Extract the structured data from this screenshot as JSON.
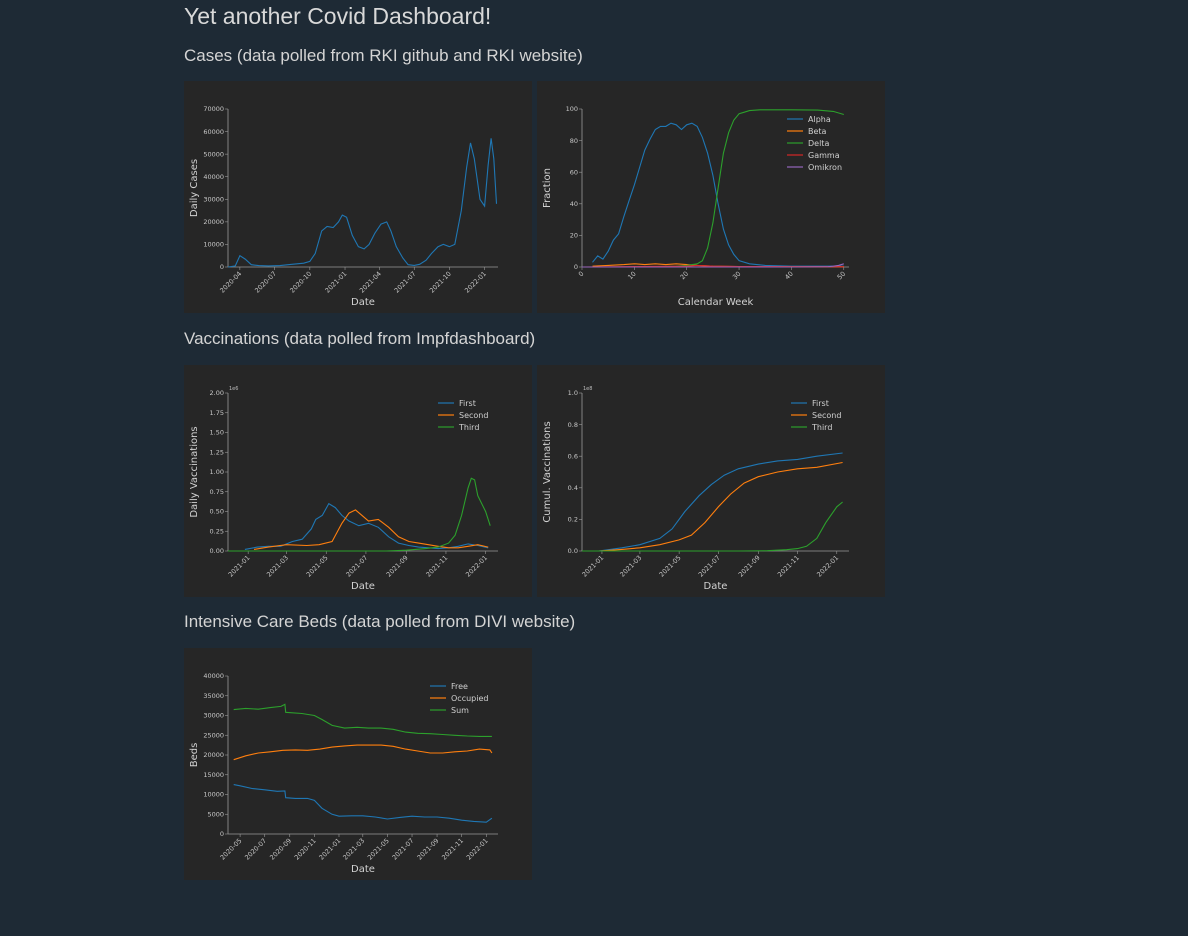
{
  "page": {
    "title": "Yet another Covid Dashboard!",
    "background": "#1e2a35",
    "panel_background": "#262626"
  },
  "sections": {
    "cases": "Cases (data polled from RKI github and RKI website)",
    "vaccinations": "Vaccinations (data polled from Impfdashboard)",
    "icu": "Intensive Care Beds (data polled from DIVI website)"
  },
  "colors": {
    "blue": "#1f77b4",
    "orange": "#ff7f0e",
    "green": "#2ca02c",
    "red": "#d62728",
    "purple": "#9467bd"
  },
  "chart_data": [
    {
      "id": "daily-cases",
      "type": "line",
      "xlabel": "Date",
      "ylabel": "Daily Cases",
      "x_ticks": [
        "2020-04",
        "2020-07",
        "2020-10",
        "2021-01",
        "2021-04",
        "2021-07",
        "2021-10",
        "2022-01"
      ],
      "xlim": [
        "2020-03-01",
        "2022-02-05"
      ],
      "y_ticks": [
        0,
        10000,
        20000,
        30000,
        40000,
        50000,
        60000,
        70000
      ],
      "ylim": [
        0,
        70000
      ],
      "legend": "none",
      "series": [
        {
          "color": "blue",
          "x": [
            "2020-03-01",
            "2020-03-20",
            "2020-04-01",
            "2020-04-15",
            "2020-05-01",
            "2020-05-20",
            "2020-06-15",
            "2020-07-15",
            "2020-08-15",
            "2020-09-15",
            "2020-10-01",
            "2020-10-15",
            "2020-11-01",
            "2020-11-15",
            "2020-12-01",
            "2020-12-15",
            "2020-12-25",
            "2021-01-05",
            "2021-01-20",
            "2021-02-05",
            "2021-02-20",
            "2021-03-05",
            "2021-03-20",
            "2021-04-05",
            "2021-04-20",
            "2021-05-01",
            "2021-05-15",
            "2021-06-01",
            "2021-06-15",
            "2021-07-01",
            "2021-07-15",
            "2021-08-01",
            "2021-08-15",
            "2021-09-01",
            "2021-09-15",
            "2021-10-01",
            "2021-10-15",
            "2021-11-01",
            "2021-11-15",
            "2021-11-25",
            "2021-12-05",
            "2021-12-20",
            "2022-01-01",
            "2022-01-10",
            "2022-01-18",
            "2022-01-25",
            "2022-02-01"
          ],
          "values": [
            0,
            500,
            5000,
            3500,
            1000,
            600,
            500,
            600,
            1200,
            1700,
            2500,
            6000,
            16000,
            18000,
            17500,
            20000,
            23000,
            22000,
            14000,
            9000,
            8000,
            10000,
            15000,
            19000,
            20000,
            16000,
            9000,
            4000,
            1000,
            700,
            1200,
            3000,
            6000,
            9000,
            10000,
            9000,
            10000,
            25000,
            44000,
            55000,
            48000,
            30000,
            27000,
            45000,
            57000,
            48000,
            28000
          ]
        }
      ]
    },
    {
      "id": "variant-fraction",
      "type": "line",
      "xlabel": "Calendar Week",
      "ylabel": "Fraction",
      "x_ticks": [
        0,
        10,
        20,
        30,
        40,
        50
      ],
      "xlim": [
        0,
        51
      ],
      "y_ticks": [
        0,
        20,
        40,
        60,
        80,
        100
      ],
      "ylim": [
        0,
        100
      ],
      "legend": "top-right",
      "series": [
        {
          "name": "Alpha",
          "color": "blue",
          "x": [
            2,
            3,
            4,
            5,
            6,
            7,
            8,
            9,
            10,
            11,
            12,
            13,
            14,
            15,
            16,
            17,
            18,
            19,
            20,
            21,
            22,
            23,
            24,
            25,
            26,
            27,
            28,
            29,
            30,
            32,
            35,
            40,
            45,
            50
          ],
          "values": [
            3,
            7,
            5,
            10,
            17,
            21,
            32,
            42,
            52,
            63,
            74,
            81,
            87,
            89,
            89,
            91,
            90,
            87,
            90,
            91,
            89,
            82,
            72,
            58,
            40,
            24,
            14,
            8,
            4,
            2,
            1,
            0.5,
            0.5,
            0.5
          ]
        },
        {
          "name": "Beta",
          "color": "orange",
          "x": [
            2,
            5,
            8,
            10,
            12,
            14,
            16,
            18,
            20,
            22,
            25,
            30,
            40,
            50
          ],
          "values": [
            0.5,
            1,
            1.5,
            2,
            1.5,
            2,
            1.5,
            2,
            1.5,
            1,
            0.5,
            0.3,
            0.2,
            0.2
          ]
        },
        {
          "name": "Delta",
          "color": "green",
          "x": [
            0,
            10,
            18,
            20,
            22,
            23,
            24,
            25,
            26,
            27,
            28,
            29,
            30,
            31,
            32,
            34,
            36,
            40,
            45,
            48,
            50
          ],
          "values": [
            0,
            0,
            0.5,
            1,
            2,
            4,
            12,
            28,
            50,
            72,
            85,
            93,
            97,
            98,
            99,
            99.5,
            99.5,
            99.5,
            99.3,
            98.5,
            96.5
          ]
        },
        {
          "name": "Gamma",
          "color": "red",
          "x": [
            0,
            10,
            20,
            22,
            25,
            30,
            40,
            50
          ],
          "values": [
            0,
            0.3,
            0.5,
            1,
            0.5,
            0.3,
            0.2,
            0.2
          ]
        },
        {
          "name": "Omikron",
          "color": "purple",
          "x": [
            0,
            40,
            47,
            48,
            49,
            50
          ],
          "values": [
            0,
            0,
            0.2,
            0.5,
            1,
            2
          ]
        }
      ]
    },
    {
      "id": "daily-vaccinations",
      "type": "line",
      "xlabel": "Date",
      "ylabel": "Daily Vaccinations",
      "y_offset_label": "1e6",
      "x_ticks": [
        "2021-01",
        "2021-03",
        "2021-05",
        "2021-07",
        "2021-09",
        "2021-11",
        "2022-01"
      ],
      "xlim": [
        "2020-12-01",
        "2022-01-20"
      ],
      "y_ticks": [
        "0.00",
        "0.25",
        "0.50",
        "0.75",
        "1.00",
        "1.25",
        "1.50",
        "1.75",
        "2.00"
      ],
      "ylim": [
        0,
        2
      ],
      "legend": "top-right",
      "series": [
        {
          "name": "First",
          "color": "blue",
          "x": [
            "2020-12-27",
            "2021-01-15",
            "2021-02-01",
            "2021-02-20",
            "2021-03-10",
            "2021-03-25",
            "2021-04-08",
            "2021-04-15",
            "2021-04-25",
            "2021-05-05",
            "2021-05-15",
            "2021-05-25",
            "2021-06-05",
            "2021-06-20",
            "2021-07-05",
            "2021-07-20",
            "2021-08-05",
            "2021-08-20",
            "2021-09-05",
            "2021-09-20",
            "2021-10-05",
            "2021-10-20",
            "2021-11-05",
            "2021-11-20",
            "2021-12-05",
            "2021-12-20",
            "2022-01-05"
          ],
          "values": [
            0.02,
            0.05,
            0.06,
            0.06,
            0.12,
            0.15,
            0.28,
            0.4,
            0.45,
            0.6,
            0.55,
            0.45,
            0.38,
            0.32,
            0.35,
            0.3,
            0.18,
            0.1,
            0.07,
            0.05,
            0.04,
            0.03,
            0.04,
            0.06,
            0.09,
            0.07,
            0.04
          ]
        },
        {
          "name": "Second",
          "color": "orange",
          "x": [
            "2021-01-10",
            "2021-02-01",
            "2021-03-01",
            "2021-04-01",
            "2021-04-20",
            "2021-05-10",
            "2021-05-25",
            "2021-06-05",
            "2021-06-15",
            "2021-06-25",
            "2021-07-05",
            "2021-07-20",
            "2021-08-05",
            "2021-08-20",
            "2021-09-05",
            "2021-09-20",
            "2021-10-05",
            "2021-10-20",
            "2021-11-05",
            "2021-11-20",
            "2021-12-05",
            "2021-12-20",
            "2022-01-05"
          ],
          "values": [
            0.02,
            0.05,
            0.08,
            0.07,
            0.08,
            0.12,
            0.35,
            0.48,
            0.52,
            0.45,
            0.38,
            0.4,
            0.3,
            0.18,
            0.12,
            0.1,
            0.08,
            0.06,
            0.04,
            0.04,
            0.06,
            0.08,
            0.05
          ]
        },
        {
          "name": "Third",
          "color": "green",
          "x": [
            "2020-12-01",
            "2021-08-01",
            "2021-09-01",
            "2021-10-01",
            "2021-10-20",
            "2021-11-05",
            "2021-11-15",
            "2021-11-25",
            "2021-12-05",
            "2021-12-10",
            "2021-12-15",
            "2021-12-20",
            "2022-01-01",
            "2022-01-08"
          ],
          "values": [
            0,
            0,
            0.01,
            0.03,
            0.05,
            0.1,
            0.2,
            0.45,
            0.8,
            0.92,
            0.9,
            0.7,
            0.5,
            0.32
          ]
        }
      ]
    },
    {
      "id": "cumulative-vaccinations",
      "type": "line",
      "xlabel": "Date",
      "ylabel": "Cumul. Vaccinations",
      "y_offset_label": "1e8",
      "x_ticks": [
        "2021-01",
        "2021-03",
        "2021-05",
        "2021-07",
        "2021-09",
        "2021-11",
        "2022-01"
      ],
      "xlim": [
        "2020-12-01",
        "2022-01-20"
      ],
      "y_ticks": [
        "0.0",
        "0.2",
        "0.4",
        "0.6",
        "0.8",
        "1.0"
      ],
      "ylim": [
        0,
        1
      ],
      "legend": "top-right",
      "series": [
        {
          "name": "First",
          "color": "blue",
          "x": [
            "2020-12-27",
            "2021-02-01",
            "2021-03-01",
            "2021-04-01",
            "2021-04-20",
            "2021-05-10",
            "2021-06-01",
            "2021-06-20",
            "2021-07-10",
            "2021-08-01",
            "2021-09-01",
            "2021-10-01",
            "2021-11-01",
            "2021-12-01",
            "2022-01-10"
          ],
          "values": [
            0,
            0.02,
            0.04,
            0.08,
            0.14,
            0.25,
            0.35,
            0.42,
            0.48,
            0.52,
            0.55,
            0.57,
            0.58,
            0.6,
            0.62
          ]
        },
        {
          "name": "Second",
          "color": "orange",
          "x": [
            "2020-12-27",
            "2021-02-01",
            "2021-03-01",
            "2021-04-01",
            "2021-05-01",
            "2021-05-20",
            "2021-06-10",
            "2021-07-01",
            "2021-07-20",
            "2021-08-10",
            "2021-09-01",
            "2021-10-01",
            "2021-11-01",
            "2021-12-01",
            "2022-01-10"
          ],
          "values": [
            0,
            0.01,
            0.02,
            0.04,
            0.07,
            0.1,
            0.18,
            0.28,
            0.36,
            0.43,
            0.47,
            0.5,
            0.52,
            0.53,
            0.56
          ]
        },
        {
          "name": "Third",
          "color": "green",
          "x": [
            "2020-12-01",
            "2021-08-01",
            "2021-09-15",
            "2021-10-15",
            "2021-11-01",
            "2021-11-15",
            "2021-12-01",
            "2021-12-15",
            "2022-01-01",
            "2022-01-10"
          ],
          "values": [
            0,
            0,
            0.002,
            0.008,
            0.015,
            0.03,
            0.08,
            0.18,
            0.28,
            0.31
          ]
        }
      ]
    },
    {
      "id": "icu-beds",
      "type": "line",
      "xlabel": "Date",
      "ylabel": "Beds",
      "x_ticks": [
        "2020-05",
        "2020-07",
        "2020-09",
        "2020-11",
        "2021-01",
        "2021-03",
        "2021-05",
        "2021-07",
        "2021-09",
        "2021-11",
        "2022-01"
      ],
      "xlim": [
        "2020-04-01",
        "2022-01-30"
      ],
      "y_ticks": [
        0,
        5000,
        10000,
        15000,
        20000,
        25000,
        30000,
        35000,
        40000
      ],
      "ylim": [
        0,
        40000
      ],
      "legend": "top-right",
      "series": [
        {
          "name": "Free",
          "color": "blue",
          "x": [
            "2020-04-15",
            "2020-05-01",
            "2020-06-01",
            "2020-07-01",
            "2020-08-01",
            "2020-08-20",
            "2020-08-22",
            "2020-09-15",
            "2020-10-15",
            "2020-11-01",
            "2020-11-20",
            "2020-12-15",
            "2021-01-01",
            "2021-02-01",
            "2021-03-01",
            "2021-04-01",
            "2021-05-01",
            "2021-06-01",
            "2021-07-01",
            "2021-08-01",
            "2021-09-01",
            "2021-10-01",
            "2021-11-01",
            "2021-12-01",
            "2022-01-01",
            "2022-01-15"
          ],
          "values": [
            12500,
            12200,
            11500,
            11200,
            10800,
            10900,
            9200,
            9000,
            9000,
            8500,
            6500,
            5000,
            4500,
            4600,
            4600,
            4300,
            3800,
            4200,
            4500,
            4300,
            4300,
            4000,
            3500,
            3200,
            3000,
            4000
          ]
        },
        {
          "name": "Occupied",
          "color": "orange",
          "x": [
            "2020-04-15",
            "2020-05-15",
            "2020-06-15",
            "2020-07-15",
            "2020-08-15",
            "2020-09-15",
            "2020-10-15",
            "2020-11-15",
            "2020-12-15",
            "2021-01-15",
            "2021-02-15",
            "2021-03-15",
            "2021-04-15",
            "2021-05-15",
            "2021-06-15",
            "2021-07-15",
            "2021-08-15",
            "2021-09-15",
            "2021-10-15",
            "2021-11-15",
            "2021-12-15",
            "2022-01-10",
            "2022-01-15"
          ],
          "values": [
            18800,
            19800,
            20500,
            20800,
            21200,
            21300,
            21200,
            21500,
            22000,
            22300,
            22500,
            22500,
            22500,
            22200,
            21500,
            21000,
            20500,
            20500,
            20800,
            21000,
            21500,
            21300,
            20500
          ]
        },
        {
          "name": "Sum",
          "color": "green",
          "x": [
            "2020-04-15",
            "2020-05-15",
            "2020-06-15",
            "2020-07-15",
            "2020-08-10",
            "2020-08-20",
            "2020-08-22",
            "2020-10-01",
            "2020-11-01",
            "2020-11-20",
            "2020-12-15",
            "2021-01-15",
            "2021-02-15",
            "2021-03-15",
            "2021-04-15",
            "2021-05-15",
            "2021-06-15",
            "2021-07-15",
            "2021-08-15",
            "2021-09-15",
            "2021-10-15",
            "2021-11-15",
            "2021-12-15",
            "2022-01-15"
          ],
          "values": [
            31500,
            31800,
            31600,
            32000,
            32300,
            32800,
            30800,
            30500,
            30000,
            29000,
            27500,
            26800,
            27000,
            26800,
            26800,
            26500,
            25800,
            25500,
            25400,
            25200,
            25000,
            24800,
            24700,
            24700
          ]
        }
      ]
    }
  ]
}
